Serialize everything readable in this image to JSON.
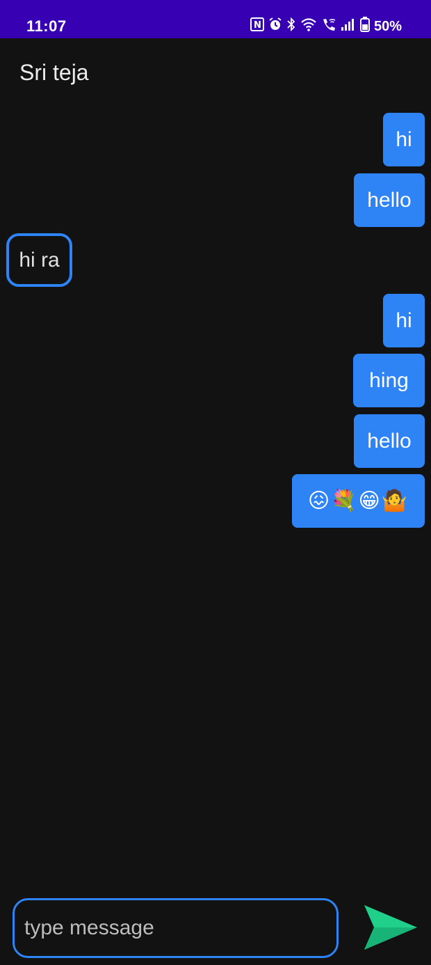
{
  "status_bar": {
    "time": "11:07",
    "battery": "50%",
    "icons": [
      "nfc-icon",
      "alarm-icon",
      "bluetooth-icon",
      "wifi-icon",
      "wifi-call-icon",
      "signal-icon",
      "battery-icon"
    ]
  },
  "chat": {
    "title": "Sri teja",
    "messages": [
      {
        "text": "hi",
        "type": "sent"
      },
      {
        "text": "hello",
        "type": "sent"
      },
      {
        "text": "hi ra",
        "type": "received"
      },
      {
        "text": "hi",
        "type": "sent"
      },
      {
        "text": "hing",
        "type": "sent"
      },
      {
        "text": "hello",
        "type": "sent"
      },
      {
        "text": "😖💐😁🤷",
        "type": "sent"
      }
    ]
  },
  "composer": {
    "placeholder": "type message",
    "value": "",
    "send_icon": "send-icon"
  },
  "colors": {
    "status_bar": "#3700b3",
    "background": "#121212",
    "accent": "#2e83f5",
    "send": "#1fcf8a"
  }
}
